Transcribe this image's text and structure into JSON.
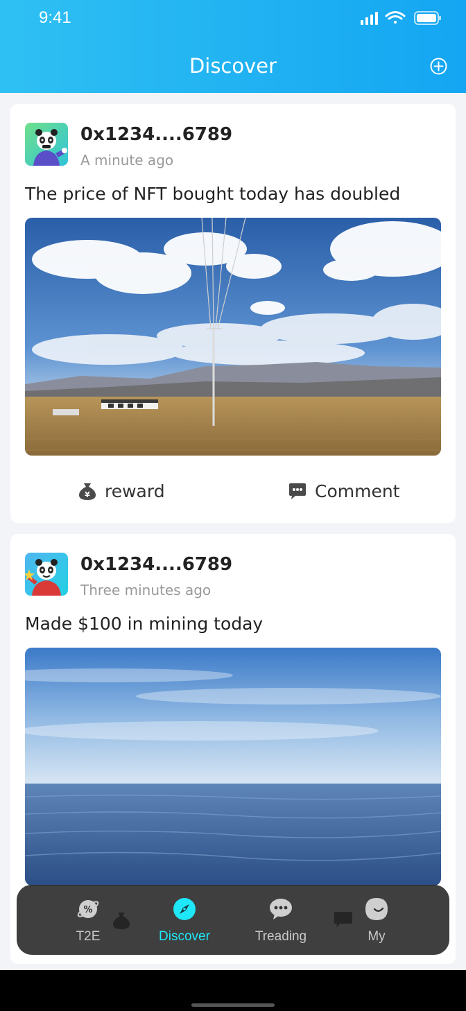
{
  "status": {
    "time": "9:41"
  },
  "header": {
    "title": "Discover",
    "add_icon": "plus-circle-icon"
  },
  "posts": [
    {
      "username": "0x1234....6789",
      "time": "A minute ago",
      "text": "The price of NFT bought today has doubled",
      "image": "landscape-grassland-power-lines",
      "reward_label": "reward",
      "comment_label": "Comment"
    },
    {
      "username": "0x1234....6789",
      "time": "Three minutes ago",
      "text": "Made $100 in mining today",
      "image": "lake-horizon-sky"
    }
  ],
  "tabbar": {
    "active": "Discover",
    "active_color": "#1ee7f7",
    "tabs": [
      {
        "label": "T2E",
        "icon": "planet-icon"
      },
      {
        "label": "Discover",
        "icon": "compass-icon"
      },
      {
        "label": "Treading",
        "icon": "chat-bubble-icon"
      },
      {
        "label": "My",
        "icon": "smile-icon"
      }
    ]
  },
  "colors": {
    "header_start": "#2fc0f3",
    "header_end": "#14a6f2"
  }
}
